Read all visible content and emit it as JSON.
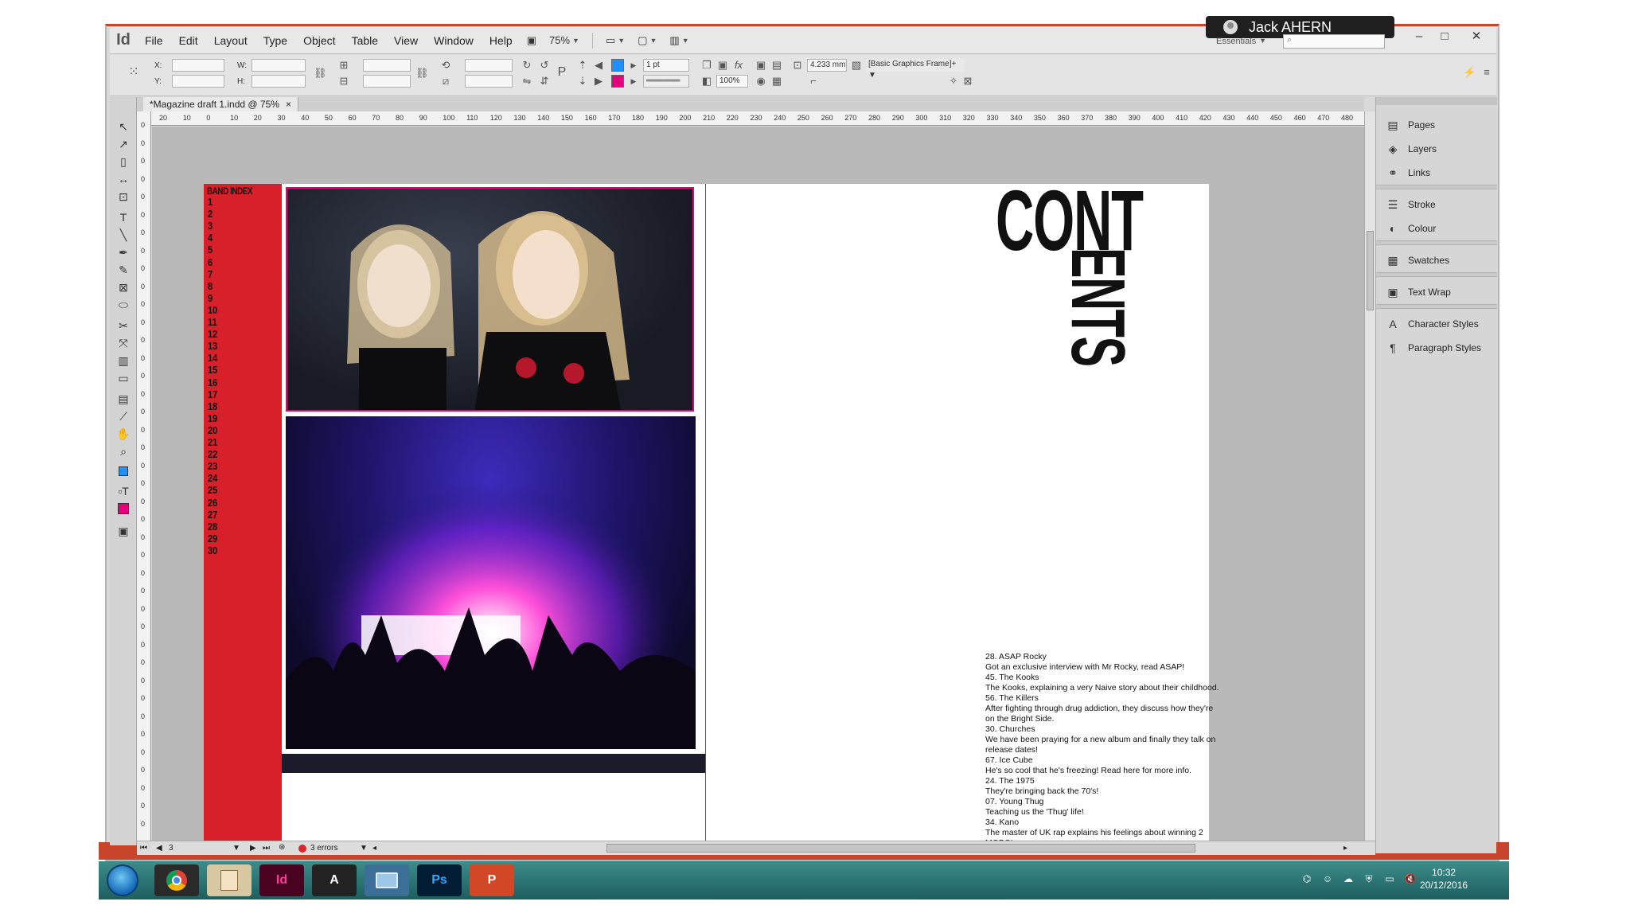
{
  "user": {
    "name": "Jack AHERN"
  },
  "app": {
    "logo": "Id"
  },
  "menu": [
    "File",
    "Edit",
    "Layout",
    "Type",
    "Object",
    "Table",
    "View",
    "Window",
    "Help"
  ],
  "toolbar": {
    "zoom": "75%",
    "stroke_weight": "1 pt",
    "opacity": "100%",
    "dimension": "4.233 mm",
    "frame_style": "[Basic Graphics Frame]+",
    "x_label": "X:",
    "y_label": "Y:",
    "w_label": "W:",
    "h_label": "H:"
  },
  "workspace": {
    "label": "Essentials",
    "search_placeholder": ""
  },
  "document": {
    "tab_title": "*Magazine draft 1.indd @ 75%"
  },
  "ruler_h": [
    "20",
    "10",
    "0",
    "10",
    "20",
    "30",
    "40",
    "50",
    "60",
    "70",
    "80",
    "90",
    "100",
    "110",
    "120",
    "130",
    "140",
    "150",
    "160",
    "170",
    "180",
    "190",
    "200",
    "210",
    "220",
    "230",
    "240",
    "250",
    "260",
    "270",
    "280",
    "290",
    "300",
    "310",
    "320",
    "330",
    "340",
    "350",
    "360",
    "370",
    "380",
    "390",
    "400",
    "410",
    "420",
    "430",
    "440",
    "450",
    "460",
    "470",
    "480"
  ],
  "ruler_v": [
    "0",
    "0",
    "0",
    "0",
    "0",
    "0",
    "0",
    "0",
    "0",
    "0",
    "0",
    "0",
    "0",
    "0",
    "0",
    "0",
    "0",
    "0",
    "0",
    "0",
    "0",
    "0",
    "0",
    "0",
    "0",
    "0",
    "0",
    "0",
    "0",
    "0",
    "0",
    "0",
    "0",
    "0",
    "0",
    "0",
    "0",
    "0",
    "0",
    "0"
  ],
  "spread": {
    "band_index_title": "BAND INDEX",
    "band_index": [
      "1",
      "2",
      "3",
      "4",
      "5",
      "6",
      "7",
      "8",
      "9",
      "10",
      "11",
      "12",
      "13",
      "14",
      "15",
      "16",
      "17",
      "18",
      "19",
      "20",
      "21",
      "22",
      "23",
      "24",
      "25",
      "26",
      "27",
      "28",
      "29",
      "30"
    ],
    "contents_part1": "CONT",
    "contents_part2": "ENTS",
    "toc": [
      "28.  ASAP Rocky",
      "Got an exclusive interview with Mr Rocky, read ASAP!",
      "45. The Kooks",
      "The Kooks, explaining a very Naive story about their childhood.",
      "56. The Killers",
      " After fighting through drug addiction, they discuss how they're",
      "on the Bright Side.",
      "30. Churches",
      " We have been praying for a new album and finally they talk on",
      "release dates!",
      "67. Ice Cube",
      " He's so cool that he's freezing! Read here for more info.",
      "24. The 1975",
      "They're bringing back the 70's!",
      "07. Young Thug",
      " Teaching us the 'Thug' life!",
      "34. Kano",
      "The master of UK rap explains his feelings about winning 2",
      "MOBO's."
    ]
  },
  "status": {
    "page": "3",
    "errors": "3 errors"
  },
  "panels": [
    {
      "label": "Pages",
      "icon": "pages-icon",
      "glyph": "▤"
    },
    {
      "label": "Layers",
      "icon": "layers-icon",
      "glyph": "◈"
    },
    {
      "label": "Links",
      "icon": "links-icon",
      "glyph": "⚭"
    },
    {
      "label": "Stroke",
      "icon": "stroke-icon",
      "glyph": "☰"
    },
    {
      "label": "Colour",
      "icon": "colour-icon",
      "glyph": "◐"
    },
    {
      "label": "Swatches",
      "icon": "swatches-icon",
      "glyph": "▦"
    },
    {
      "label": "Text Wrap",
      "icon": "text-wrap-icon",
      "glyph": "▣"
    },
    {
      "label": "Character Styles",
      "icon": "character-styles-icon",
      "glyph": "A"
    },
    {
      "label": "Paragraph Styles",
      "icon": "paragraph-styles-icon",
      "glyph": "¶"
    }
  ],
  "taskbar": {
    "apps": [
      {
        "name": "chrome",
        "label": "",
        "bg": "#2a2a2a",
        "fg": "#ffffff"
      },
      {
        "name": "contacts",
        "label": "",
        "bg": "#d8c7a3",
        "fg": "#333333"
      },
      {
        "name": "indesign",
        "label": "Id",
        "bg": "#49021f",
        "fg": "#ff3a9e"
      },
      {
        "name": "font-app",
        "label": "A",
        "bg": "#222222",
        "fg": "#ffffff"
      },
      {
        "name": "explorer",
        "label": "",
        "bg": "#3b6f97",
        "fg": "#ffffff"
      },
      {
        "name": "photoshop",
        "label": "Ps",
        "bg": "#001d34",
        "fg": "#31a8ff"
      },
      {
        "name": "powerpoint",
        "label": "P",
        "bg": "#d24726",
        "fg": "#ffffff"
      }
    ],
    "time": "10:32",
    "date": "20/12/2016"
  },
  "colors": {
    "accent_red": "#d8202a",
    "magenta": "#e6007e",
    "window_border": "#c8452b",
    "taskbar": "#2f7a7a"
  }
}
